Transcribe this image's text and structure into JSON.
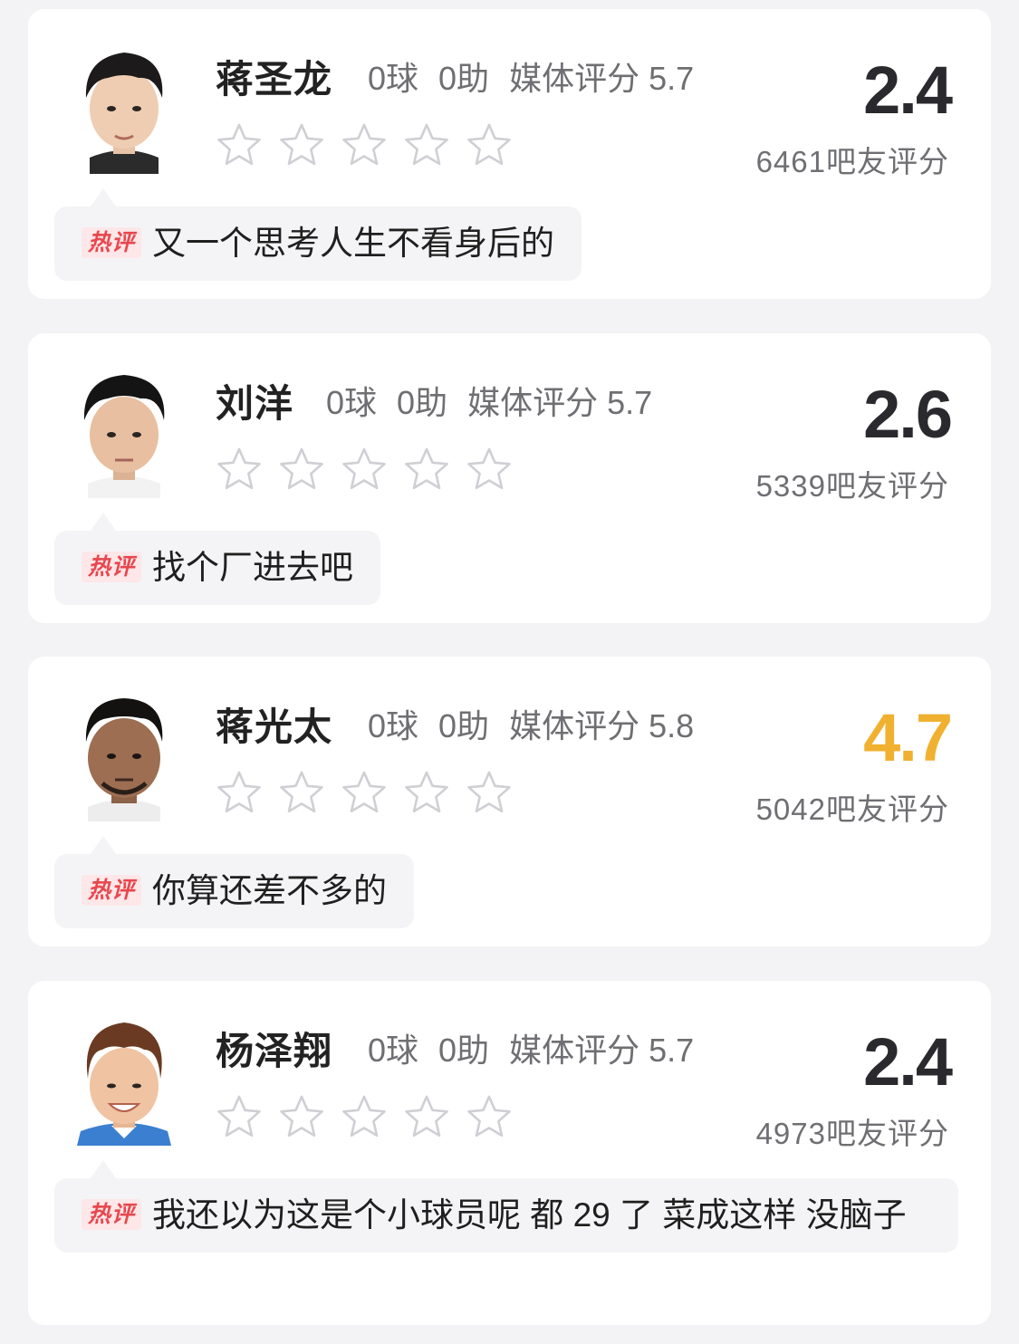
{
  "badge_label": "热评",
  "players": [
    {
      "name": "蒋圣龙",
      "goals": "0球",
      "assists": "0助",
      "media_rating": "媒体评分 5.7",
      "user_rating": "2.4",
      "voters": "6461吧友评分",
      "stars_filled": 0,
      "hot_comment": "又一个思考人生不看身后的",
      "rating_color": "#2a2a2e",
      "jersey_color": "#ffffff"
    },
    {
      "name": "刘洋",
      "goals": "0球",
      "assists": "0助",
      "media_rating": "媒体评分 5.7",
      "user_rating": "2.6",
      "voters": "5339吧友评分",
      "stars_filled": 0,
      "hot_comment": "找个厂进去吧",
      "rating_color": "#2a2a2e",
      "jersey_color": "#ffffff"
    },
    {
      "name": "蒋光太",
      "goals": "0球",
      "assists": "0助",
      "media_rating": "媒体评分 5.8",
      "user_rating": "4.7",
      "voters": "5042吧友评分",
      "stars_filled": 0,
      "hot_comment": "你算还差不多的",
      "rating_color": "#f0b131",
      "jersey_color": "#ffffff"
    },
    {
      "name": "杨泽翔",
      "goals": "0球",
      "assists": "0助",
      "media_rating": "媒体评分 5.7",
      "user_rating": "2.4",
      "voters": "4973吧友评分",
      "stars_filled": 0,
      "hot_comment": "我还以为这是个小球员呢 都 29 了 菜成这样 没脑子",
      "rating_color": "#2a2a2e",
      "jersey_color": "#3b7fd0"
    }
  ],
  "colors": {
    "page_background": "#f3f3f5",
    "card_background": "#ffffff",
    "star_outline": "#cfcfd4",
    "badge_text": "#e8474f",
    "badge_background": "#fde7e8",
    "highlight_rating": "#f0b131"
  },
  "icons": {
    "star": "star-outline-icon",
    "avatar": "player-avatar"
  }
}
